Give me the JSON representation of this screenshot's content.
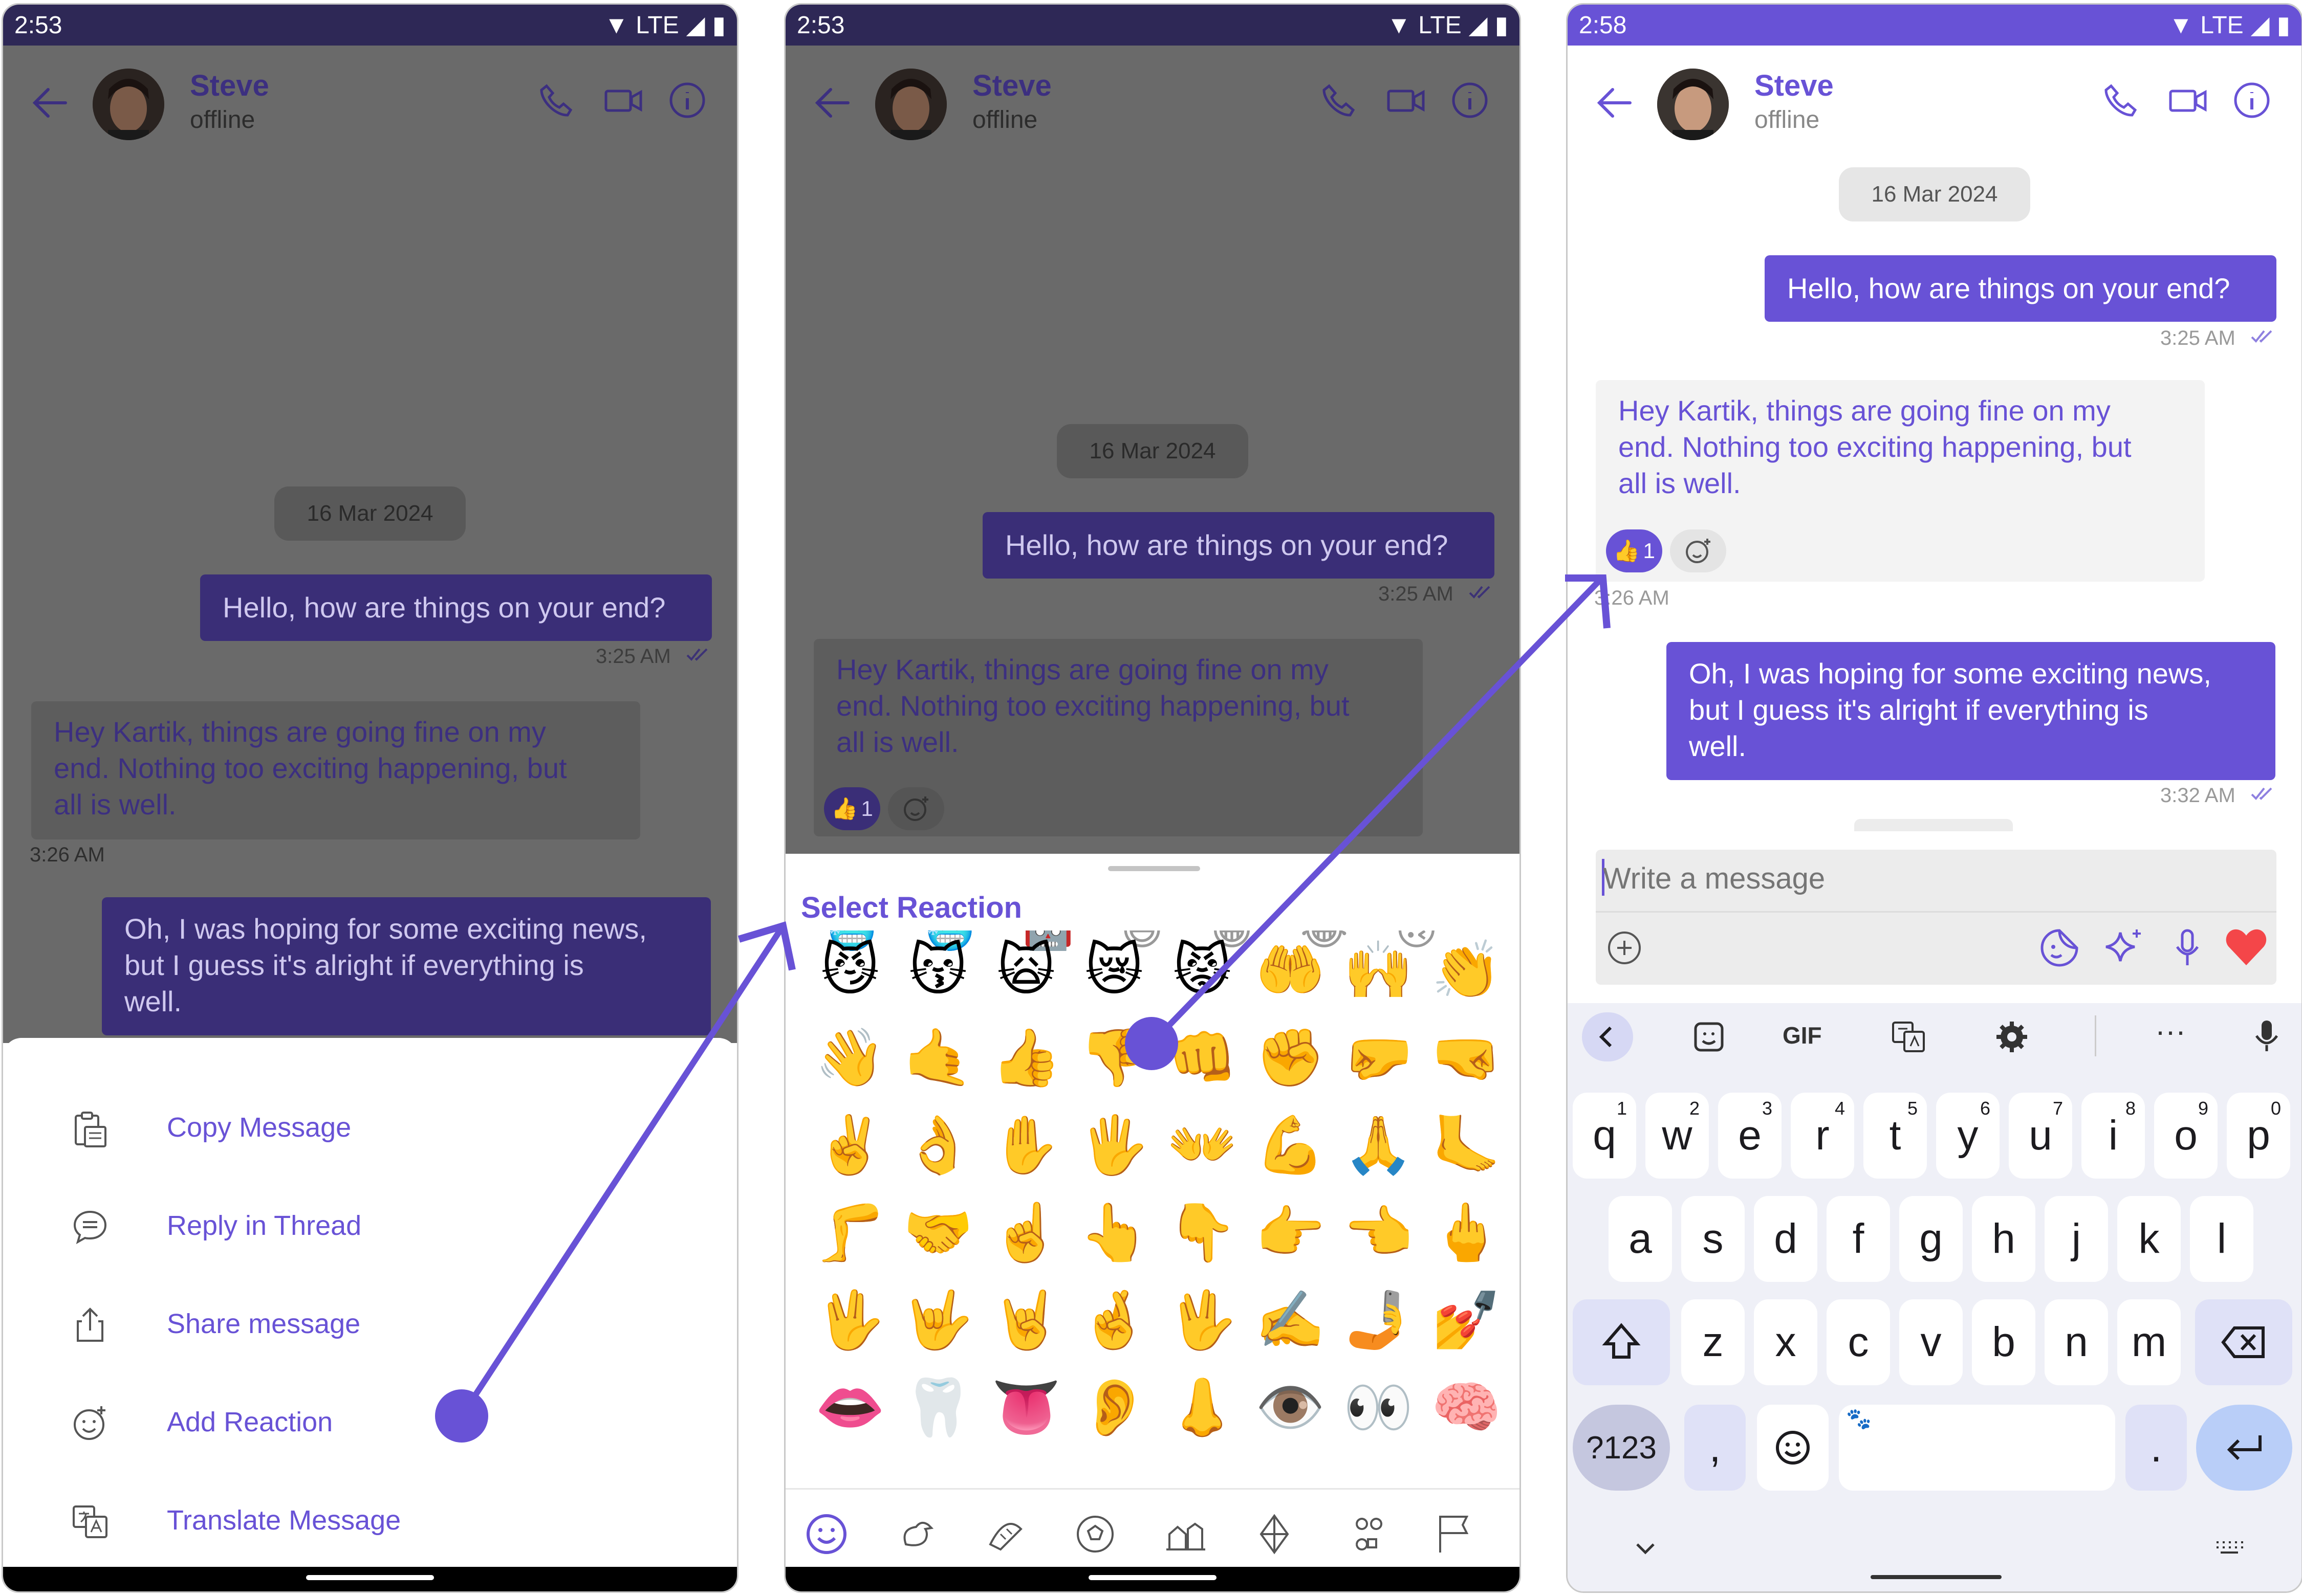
{
  "phones": [
    {
      "time": "2:53",
      "network": "LTE"
    },
    {
      "time": "2:53",
      "network": "LTE"
    },
    {
      "time": "2:58",
      "network": "LTE"
    }
  ],
  "chat": {
    "contact_name": "Steve",
    "contact_status": "offline",
    "date_separator": "16 Mar 2024",
    "messages": [
      {
        "direction": "outgoing",
        "text": "Hello, how are things on your end?",
        "time": "3:25 AM"
      },
      {
        "direction": "incoming",
        "lines": [
          "Hey Kartik, things are going fine on my",
          "end. Nothing too exciting happening, but",
          "all is well."
        ],
        "time": "3:26 AM",
        "reaction": {
          "emoji": "👍",
          "count": "1"
        }
      },
      {
        "direction": "outgoing",
        "lines": [
          "Oh, I was hoping for some exciting news,",
          "but I guess it's alright if everything is",
          "well."
        ],
        "time": "3:32 AM"
      }
    ]
  },
  "options_sheet": {
    "items": [
      {
        "label": "Copy Message",
        "icon": "clipboard-icon"
      },
      {
        "label": "Reply in Thread",
        "icon": "thread-bubble-icon"
      },
      {
        "label": "Share message",
        "icon": "share-icon"
      },
      {
        "label": "Add Reaction",
        "icon": "add-reaction-icon"
      },
      {
        "label": "Translate Message",
        "icon": "translate-icon"
      }
    ]
  },
  "reaction_picker": {
    "title": "Select Reaction",
    "emoji": [
      "😼",
      "😽",
      "🙀",
      "😿",
      "😾",
      "🤲",
      "🙌",
      "👏",
      "👋",
      "🤙",
      "👍",
      "👎",
      "👊",
      "✊",
      "🤛",
      "🤜",
      "✌️",
      "👌",
      "✋",
      "🖐️",
      "👐",
      "💪",
      "🙏",
      "🦶",
      "🦵",
      "🤝",
      "☝️",
      "👆",
      "👇",
      "👉",
      "👈",
      "🖕",
      "🖖",
      "🤟",
      "🤘",
      "🤞",
      "🖖",
      "✍️",
      "🤳",
      "💅",
      "👄",
      "🦷",
      "👅",
      "👂",
      "👃",
      "👁️",
      "👀",
      "🧠"
    ],
    "categories": [
      "smiley-icon",
      "animal-icon",
      "food-icon",
      "activity-icon",
      "travel-icon",
      "objects-icon",
      "symbols-icon",
      "flag-icon"
    ]
  },
  "composer": {
    "placeholder": "Write a message"
  },
  "keyboard": {
    "toolbar": [
      "back-icon",
      "sticker-icon",
      "GIF",
      "translate-icon",
      "gear-icon",
      "more-icon",
      "mic-icon"
    ],
    "row1": [
      [
        "q",
        "1"
      ],
      [
        "w",
        "2"
      ],
      [
        "e",
        "3"
      ],
      [
        "r",
        "4"
      ],
      [
        "t",
        "5"
      ],
      [
        "y",
        "6"
      ],
      [
        "u",
        "7"
      ],
      [
        "i",
        "8"
      ],
      [
        "o",
        "9"
      ],
      [
        "p",
        "0"
      ]
    ],
    "row2": [
      "a",
      "s",
      "d",
      "f",
      "g",
      "h",
      "j",
      "k",
      "l"
    ],
    "row3": [
      "z",
      "x",
      "c",
      "v",
      "b",
      "n",
      "m"
    ],
    "sym_label": "?123",
    "comma": ",",
    "period": "."
  },
  "colors": {
    "accent": "#6852d6",
    "dim_overlay": "#6a6a6a",
    "dark_accent": "#3c2f80",
    "heart": "#f44649"
  }
}
